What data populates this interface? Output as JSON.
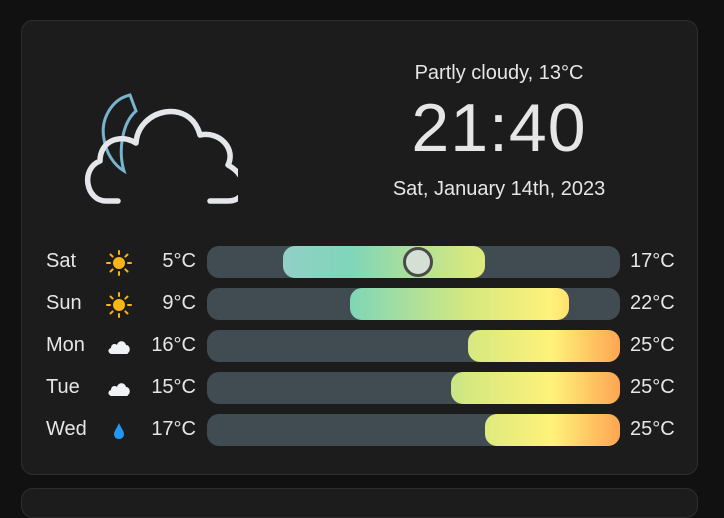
{
  "weather": {
    "condition": "Partly cloudy, 13°C",
    "time": "21:40",
    "date": "Sat, January 14th, 2023",
    "current_icon": "night-partly-cloudy-icon"
  },
  "forecast": [
    {
      "day": "Sat",
      "icon": "sun-icon",
      "low": "5°C",
      "high": "17°C"
    },
    {
      "day": "Sun",
      "icon": "sun-icon",
      "low": "9°C",
      "high": "22°C"
    },
    {
      "day": "Mon",
      "icon": "cloud-icon",
      "low": "16°C",
      "high": "25°C"
    },
    {
      "day": "Tue",
      "icon": "cloud-icon",
      "low": "15°C",
      "high": "25°C"
    },
    {
      "day": "Wed",
      "icon": "rain-drop-icon",
      "low": "17°C",
      "high": "25°C"
    }
  ],
  "range_scale": {
    "min": 0.5,
    "max": 25
  },
  "range_values": [
    {
      "low": 5,
      "high": 17,
      "current": 13
    },
    {
      "low": 9,
      "high": 22
    },
    {
      "low": 16,
      "high": 25
    },
    {
      "low": 15,
      "high": 25
    },
    {
      "low": 17,
      "high": 25
    }
  ],
  "colors": {
    "cold": "#a9c7d9",
    "cool": "#7fd6b8",
    "mild": "#d5e87f",
    "warm": "#fff27a",
    "hot": "#ffa552",
    "track": "#414c52",
    "sun": "#f8b616",
    "drop": "#2196f3"
  }
}
